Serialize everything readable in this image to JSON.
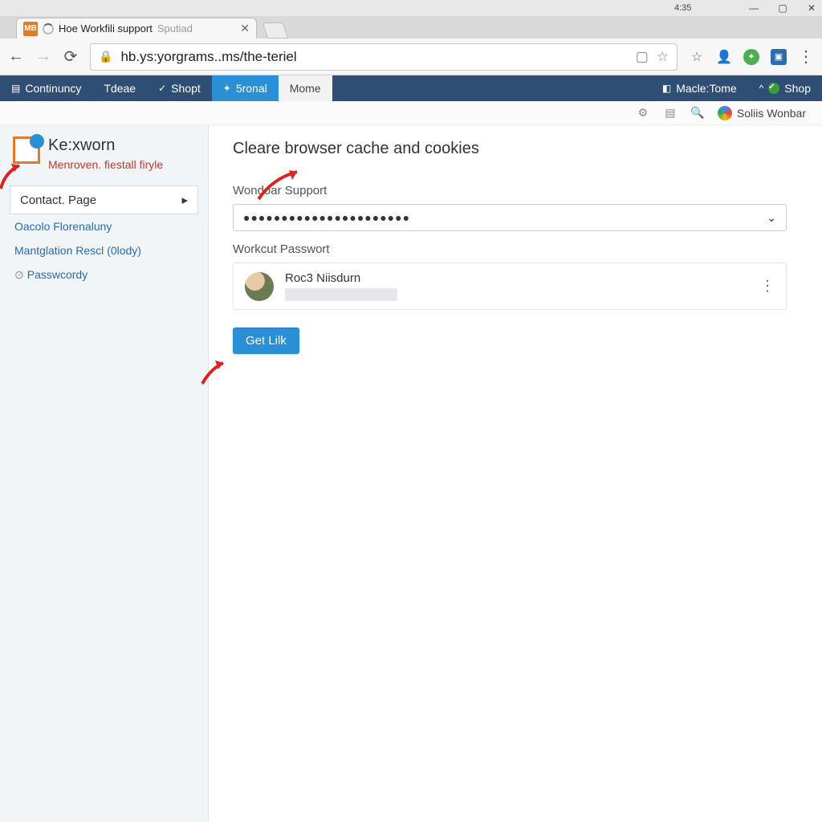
{
  "window": {
    "time_text": "4:35",
    "controls": {
      "min": "—",
      "max": "▢",
      "close": "✕"
    }
  },
  "tab": {
    "favicon_text": "MB",
    "title_strong": "Hoe Workfili support",
    "title_weak": "Sputiad",
    "close": "✕"
  },
  "addressbar": {
    "url": "hb.ys:yorgrams..ms/the-teriel"
  },
  "appnav": {
    "items": [
      {
        "icon": "▤",
        "label": "Continuncy"
      },
      {
        "icon": "",
        "label": "Tdeae"
      },
      {
        "icon": "✓",
        "label": "Shopt"
      },
      {
        "icon": "✦",
        "label": "5ronal"
      },
      {
        "icon": "",
        "label": "Mome"
      }
    ],
    "right": [
      {
        "icon": "◧",
        "label": "Macle:Tome"
      },
      {
        "icon": "✔",
        "label": "Shop",
        "caret": "^"
      }
    ]
  },
  "apphead": {
    "user_name": "Soliis Wonbar"
  },
  "brand": {
    "title": "Ke:xworn",
    "subtitle": "Menroven. fiestall firyle"
  },
  "sidebar": {
    "category": "Contact. Page",
    "links": [
      {
        "label": "Oacolo Florenaluny"
      },
      {
        "label": "Mantglation Rescl (0lody)"
      },
      {
        "label": "Passwcordy",
        "icon": "⊙"
      }
    ]
  },
  "main": {
    "heading": "Cleare browser cache and cookies",
    "field1_label": "Wondoar Support",
    "field1_value": "●●●●●●●●●●●●●●●●●●●●●●",
    "field2_label": "Workcut Passwort",
    "card_name": "Roc3 Niisdurn",
    "button": "Get Lilk"
  }
}
